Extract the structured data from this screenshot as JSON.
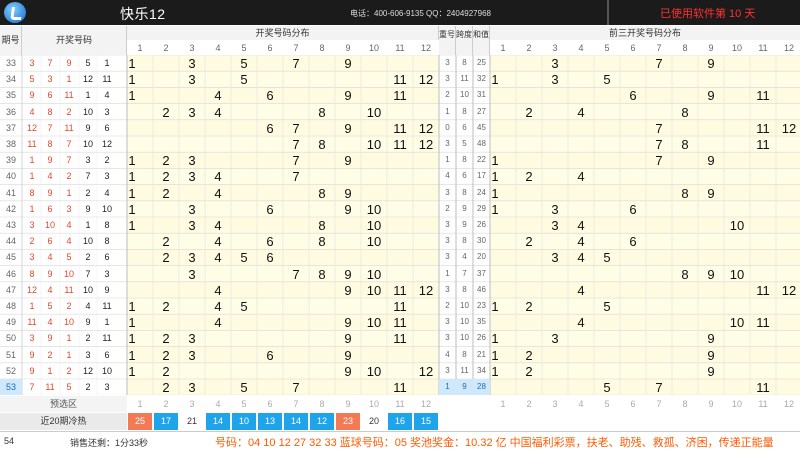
{
  "header": {
    "title": "快乐12",
    "contact": "电话：400-606-9135 QQ：2404927968",
    "usage": "已使用软件第 10 天"
  },
  "columns": {
    "issue": "期号",
    "winning": "开奖号码",
    "dist": "开奖号码分布",
    "repeat": "重号",
    "span": "跨度",
    "sum": "和值",
    "front3": "前三开奖号码分布",
    "numbers": [
      "1",
      "2",
      "3",
      "4",
      "5",
      "6",
      "7",
      "8",
      "9",
      "10",
      "11",
      "12"
    ]
  },
  "rows": [
    {
      "issue": "33",
      "balls": [
        "3",
        "7",
        "9",
        "5",
        "1"
      ],
      "dist": [
        1,
        3,
        5,
        7,
        9
      ],
      "repeat": "3",
      "span": "8",
      "sum": "25",
      "front3": [
        3,
        7,
        9
      ]
    },
    {
      "issue": "34",
      "balls": [
        "5",
        "3",
        "1",
        "12",
        "11"
      ],
      "dist": [
        1,
        3,
        5,
        11,
        12
      ],
      "repeat": "3",
      "span": "11",
      "sum": "32",
      "front3": [
        1,
        3,
        5
      ]
    },
    {
      "issue": "35",
      "balls": [
        "9",
        "6",
        "11",
        "1",
        "4"
      ],
      "dist": [
        1,
        4,
        6,
        9,
        11
      ],
      "repeat": "2",
      "span": "10",
      "sum": "31",
      "front3": [
        6,
        9,
        11
      ]
    },
    {
      "issue": "36",
      "balls": [
        "4",
        "8",
        "2",
        "10",
        "3"
      ],
      "dist": [
        2,
        3,
        4,
        8,
        10
      ],
      "repeat": "1",
      "span": "8",
      "sum": "27",
      "front3": [
        2,
        4,
        8
      ]
    },
    {
      "issue": "37",
      "balls": [
        "12",
        "7",
        "11",
        "9",
        "6"
      ],
      "dist": [
        6,
        7,
        9,
        11,
        12
      ],
      "repeat": "0",
      "span": "6",
      "sum": "45",
      "front3": [
        7,
        11,
        12
      ]
    },
    {
      "issue": "38",
      "balls": [
        "11",
        "8",
        "7",
        "10",
        "12"
      ],
      "dist": [
        7,
        8,
        10,
        11,
        12
      ],
      "repeat": "3",
      "span": "5",
      "sum": "48",
      "front3": [
        7,
        8,
        11
      ]
    },
    {
      "issue": "39",
      "balls": [
        "1",
        "9",
        "7",
        "3",
        "2"
      ],
      "dist": [
        1,
        2,
        3,
        7,
        9
      ],
      "repeat": "1",
      "span": "8",
      "sum": "22",
      "front3": [
        1,
        7,
        9
      ]
    },
    {
      "issue": "40",
      "balls": [
        "1",
        "4",
        "2",
        "7",
        "3"
      ],
      "dist": [
        1,
        2,
        3,
        4,
        7
      ],
      "repeat": "4",
      "span": "6",
      "sum": "17",
      "front3": [
        1,
        2,
        4
      ]
    },
    {
      "issue": "41",
      "balls": [
        "8",
        "9",
        "1",
        "2",
        "4"
      ],
      "dist": [
        1,
        2,
        4,
        8,
        9
      ],
      "repeat": "3",
      "span": "8",
      "sum": "24",
      "front3": [
        1,
        8,
        9
      ]
    },
    {
      "issue": "42",
      "balls": [
        "1",
        "6",
        "3",
        "9",
        "10"
      ],
      "dist": [
        1,
        3,
        6,
        9,
        10
      ],
      "repeat": "2",
      "span": "9",
      "sum": "29",
      "front3": [
        1,
        3,
        6
      ]
    },
    {
      "issue": "43",
      "balls": [
        "3",
        "10",
        "4",
        "1",
        "8"
      ],
      "dist": [
        1,
        3,
        4,
        8,
        10
      ],
      "repeat": "3",
      "span": "9",
      "sum": "26",
      "front3": [
        3,
        4,
        10
      ]
    },
    {
      "issue": "44",
      "balls": [
        "2",
        "6",
        "4",
        "10",
        "8"
      ],
      "dist": [
        2,
        4,
        6,
        8,
        10
      ],
      "repeat": "3",
      "span": "8",
      "sum": "30",
      "front3": [
        2,
        4,
        6
      ]
    },
    {
      "issue": "45",
      "balls": [
        "3",
        "4",
        "5",
        "2",
        "6"
      ],
      "dist": [
        2,
        3,
        4,
        5,
        6
      ],
      "repeat": "3",
      "span": "4",
      "sum": "20",
      "front3": [
        3,
        4,
        5
      ]
    },
    {
      "issue": "46",
      "balls": [
        "8",
        "9",
        "10",
        "7",
        "3"
      ],
      "dist": [
        3,
        7,
        8,
        9,
        10
      ],
      "repeat": "1",
      "span": "7",
      "sum": "37",
      "front3": [
        8,
        9,
        10
      ]
    },
    {
      "issue": "47",
      "balls": [
        "12",
        "4",
        "11",
        "10",
        "9"
      ],
      "dist": [
        4,
        9,
        10,
        11,
        12
      ],
      "repeat": "3",
      "span": "8",
      "sum": "46",
      "front3": [
        4,
        11,
        12
      ]
    },
    {
      "issue": "48",
      "balls": [
        "1",
        "5",
        "2",
        "4",
        "11"
      ],
      "dist": [
        1,
        2,
        4,
        5,
        11
      ],
      "repeat": "2",
      "span": "10",
      "sum": "23",
      "front3": [
        1,
        2,
        5
      ]
    },
    {
      "issue": "49",
      "balls": [
        "11",
        "4",
        "10",
        "9",
        "1"
      ],
      "dist": [
        1,
        4,
        9,
        10,
        11
      ],
      "repeat": "3",
      "span": "10",
      "sum": "35",
      "front3": [
        4,
        10,
        11
      ]
    },
    {
      "issue": "50",
      "balls": [
        "3",
        "9",
        "1",
        "2",
        "11"
      ],
      "dist": [
        1,
        2,
        3,
        9,
        11
      ],
      "repeat": "3",
      "span": "10",
      "sum": "26",
      "front3": [
        1,
        3,
        9
      ]
    },
    {
      "issue": "51",
      "balls": [
        "9",
        "2",
        "1",
        "3",
        "6"
      ],
      "dist": [
        1,
        2,
        3,
        6,
        9
      ],
      "repeat": "4",
      "span": "8",
      "sum": "21",
      "front3": [
        1,
        2,
        9
      ]
    },
    {
      "issue": "52",
      "balls": [
        "9",
        "1",
        "2",
        "12",
        "10"
      ],
      "dist": [
        1,
        2,
        9,
        10,
        12
      ],
      "repeat": "3",
      "span": "11",
      "sum": "34",
      "front3": [
        1,
        2,
        9
      ]
    },
    {
      "issue": "53",
      "balls": [
        "7",
        "11",
        "5",
        "2",
        "3"
      ],
      "dist": [
        2,
        3,
        5,
        7,
        11
      ],
      "repeat": "1",
      "span": "9",
      "sum": "28",
      "front3": [
        5,
        7,
        11
      ]
    }
  ],
  "preselect": {
    "label": "预选区",
    "numbers": [
      "1",
      "2",
      "3",
      "4",
      "5",
      "6",
      "7",
      "8",
      "9",
      "10",
      "11",
      "12"
    ]
  },
  "hotcold": {
    "label": "近20期冷热",
    "values": [
      "25",
      "17",
      "21",
      "14",
      "10",
      "13",
      "14",
      "12",
      "23",
      "20",
      "16",
      "15"
    ]
  },
  "footer": {
    "issue": "54",
    "countdown": "销售还剩：1分33秒",
    "marquee": "号码：04 10 12 27 32 33 蓝球号码：05 奖池奖金：10.32 亿 中国福利彩票，扶老、助残、救孤、济困，传递正能量"
  },
  "colors": {
    "red": "#f47a56",
    "blue": "#1ea4ea",
    "topbar": "#1b1b1b",
    "usage": "#ff3030",
    "marquee": "#ff5a00"
  }
}
